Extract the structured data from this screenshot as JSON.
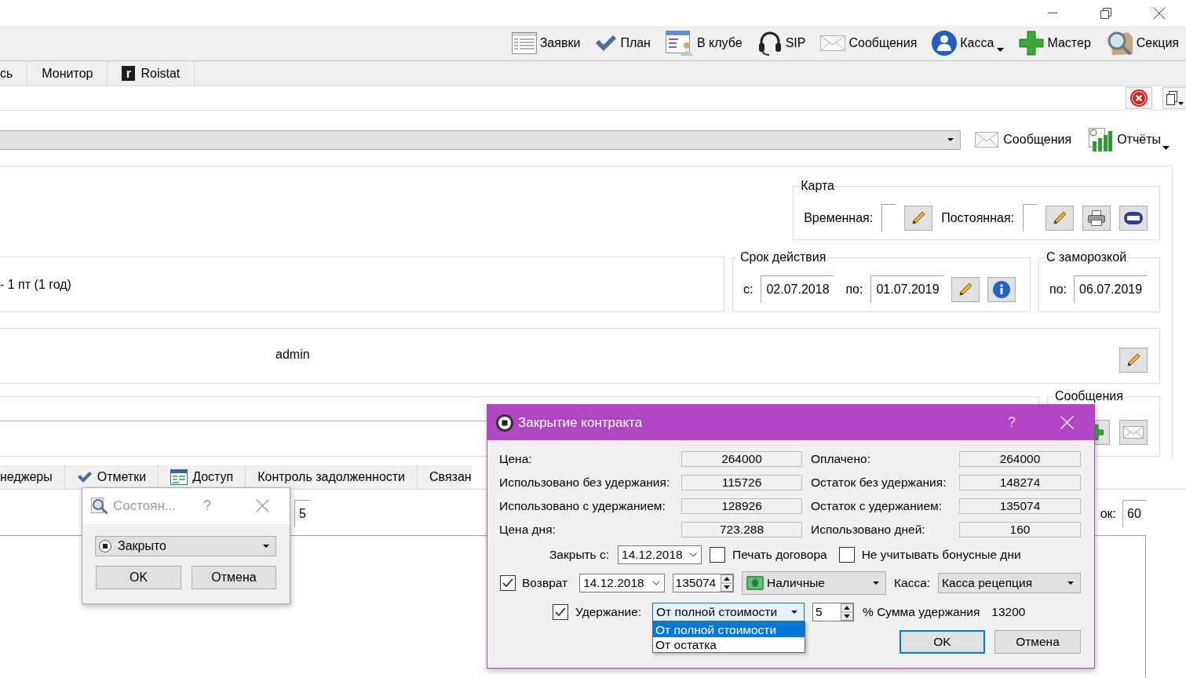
{
  "toolbar": [
    {
      "label": "Заявки",
      "dropdown": false
    },
    {
      "label": "План",
      "dropdown": false
    },
    {
      "label": "В клубе",
      "dropdown": false
    },
    {
      "label": "SIP",
      "dropdown": false
    },
    {
      "label": "Сообщения",
      "dropdown": false
    },
    {
      "label": "Касса",
      "dropdown": true
    },
    {
      "label": "Мастер",
      "dropdown": false
    },
    {
      "label": "Секция",
      "dropdown": false
    }
  ],
  "tabs": [
    {
      "label": "сь",
      "selected": false
    },
    {
      "label": "Монитор",
      "selected": false
    },
    {
      "logo": "r",
      "label": "Roistat",
      "selected": false
    }
  ],
  "header": {
    "buttons": [
      {
        "label": "Сообщения",
        "dropdown": false
      },
      {
        "label": "Отчёты",
        "dropdown": true
      }
    ]
  },
  "card": {
    "title": "Карта",
    "temporary_label": "Временная:",
    "permanent_label": "Постоянная:"
  },
  "term": "- 1 пт (1 год)",
  "validity": {
    "title": "Срок действия",
    "from_label": "с:",
    "from": "02.07.2018",
    "to_label": "по:",
    "to": "01.07.2019"
  },
  "freeze": {
    "title": "С заморозкой",
    "to_label": "по:",
    "to": "06.07.2019"
  },
  "manager": "admin",
  "messages": {
    "title": "Сообщения"
  },
  "lower_tabs": [
    {
      "label": "неджеры",
      "selected": false
    },
    {
      "label": "Отметки",
      "selected": false
    },
    {
      "label": "Доступ",
      "selected": false
    },
    {
      "label": "Контроль задолженности",
      "selected": false
    },
    {
      "label": "Связан",
      "selected": false
    }
  ],
  "lower_panel": {
    "left_field": "5",
    "right_label": "ок:",
    "right_field": "60"
  },
  "state_dialog": {
    "title": "Состоян...",
    "active": false,
    "help": "?",
    "status": "Закрыто",
    "buttons": [
      "OK",
      "Отмена"
    ]
  },
  "close_dialog": {
    "title": "Закрытие контракта",
    "active": true,
    "help": "?",
    "stats": [
      {
        "label": "Цена:",
        "value": "264000"
      },
      {
        "label": "Оплачено:",
        "value": "264000"
      },
      {
        "label": "Использовано без удержания:",
        "value": "115726"
      },
      {
        "label": "Остаток без удержания:",
        "value": "148274"
      },
      {
        "label": "Использовано с удержанием:",
        "value": "128926"
      },
      {
        "label": "Остаток с удержанием:",
        "value": "135074"
      },
      {
        "label": "Цена дня:",
        "value": "723.288"
      },
      {
        "label": "Использовано дней:",
        "value": "160"
      }
    ],
    "close_from": {
      "label": "Закрыть с:",
      "value": "14.12.2018"
    },
    "options": [
      {
        "label": "Печать договора",
        "checked": false
      },
      {
        "label": "Не учитывать бонусные дни",
        "checked": false
      }
    ],
    "refund": {
      "label": "Возврат",
      "checked": true,
      "date": "14.12.2018",
      "amount": "135074",
      "method": "Наличные",
      "cash_label": "Касса:",
      "cash_desk": "Касса рецепция"
    },
    "withholding": {
      "label": "Удержание:",
      "checked": true,
      "mode": "От полной стоимости",
      "expanded": true,
      "options": [
        {
          "label": "От полной стоимости",
          "selected": true
        },
        {
          "label": "От остатка",
          "selected": false
        }
      ],
      "percent": "5",
      "sum_label": "% Сумма удержания",
      "sum": "13200"
    },
    "buttons": [
      {
        "label": "OK",
        "default": true
      },
      {
        "label": "Отмена",
        "default": false
      }
    ]
  }
}
